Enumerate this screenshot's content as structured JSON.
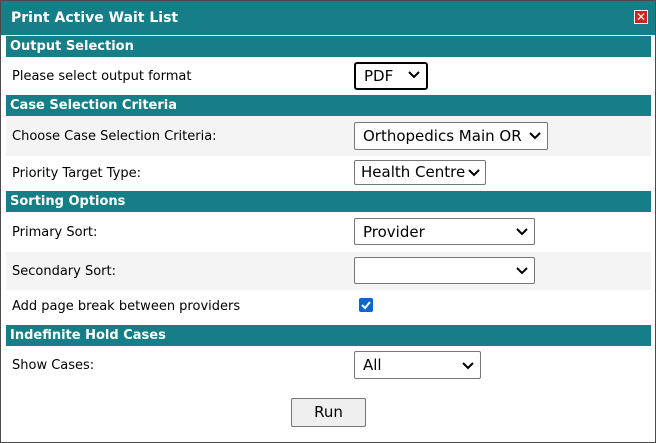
{
  "dialog": {
    "title": "Print Active Wait List",
    "close_glyph": "✕"
  },
  "sections": {
    "output": {
      "header": "Output Selection",
      "format_label": "Please select output format",
      "format_value": "PDF"
    },
    "case_selection": {
      "header": "Case Selection Criteria",
      "criteria_label": "Choose Case Selection Criteria:",
      "criteria_value": "Orthopedics Main OR",
      "priority_label": "Priority Target Type:",
      "priority_value": "Health Centre"
    },
    "sorting": {
      "header": "Sorting Options",
      "primary_label": "Primary Sort:",
      "primary_value": "Provider",
      "secondary_label": "Secondary Sort:",
      "secondary_value": "",
      "pagebreak_label": "Add page break between providers",
      "pagebreak_checked": true
    },
    "indefinite_hold": {
      "header": "Indefinite Hold Cases",
      "show_label": "Show Cases:",
      "show_value": "All"
    }
  },
  "actions": {
    "run_label": "Run"
  },
  "colors": {
    "header_teal": "#157e86",
    "close_red": "#d3211c",
    "checkbox_blue": "#0b66d0"
  }
}
